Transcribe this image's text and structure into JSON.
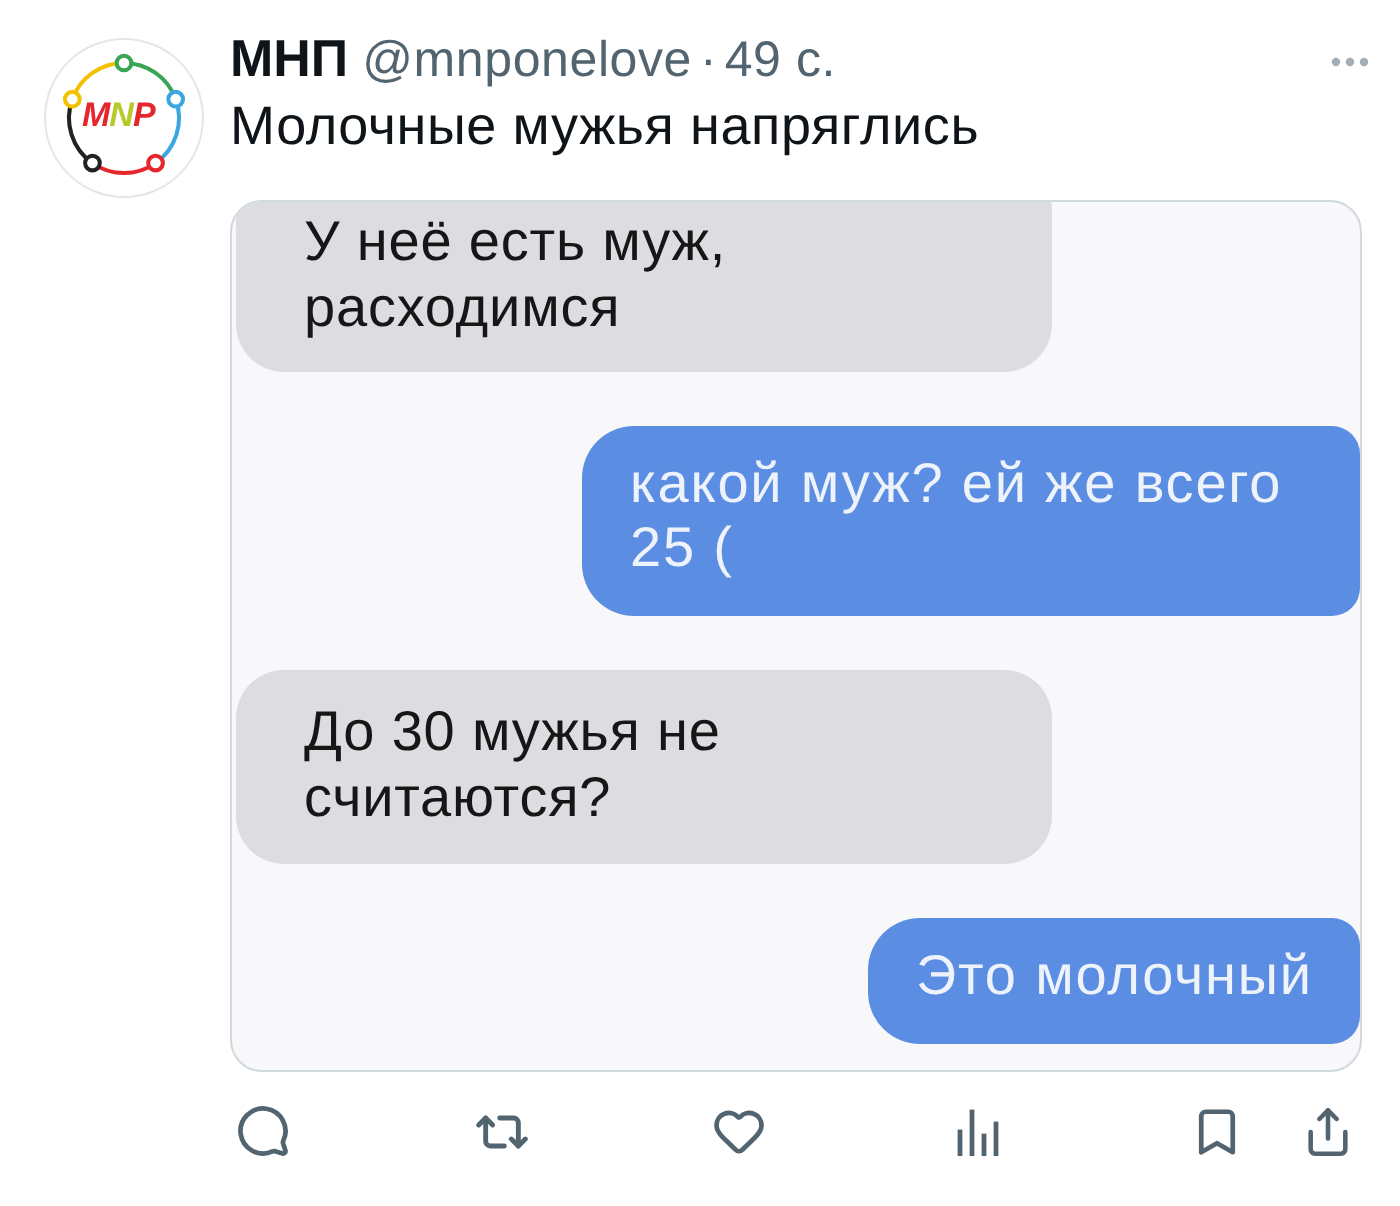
{
  "author": {
    "name": "МНП",
    "handle": "@mnponelove",
    "separator": "·",
    "time": "49 с.",
    "avatar_text": "MNP"
  },
  "text": "Молочные мужья напряглись",
  "chat_image": {
    "messages": [
      {
        "kind": "received",
        "lines": [
          "У неё есть муж,",
          "расходимся"
        ]
      },
      {
        "kind": "sent",
        "lines": [
          "какой муж? ей же всего",
          "25 ("
        ]
      },
      {
        "kind": "received",
        "lines": [
          "До 30 мужья не",
          "считаются?"
        ]
      },
      {
        "kind": "sent",
        "lines": [
          "Это молочный"
        ]
      }
    ]
  }
}
